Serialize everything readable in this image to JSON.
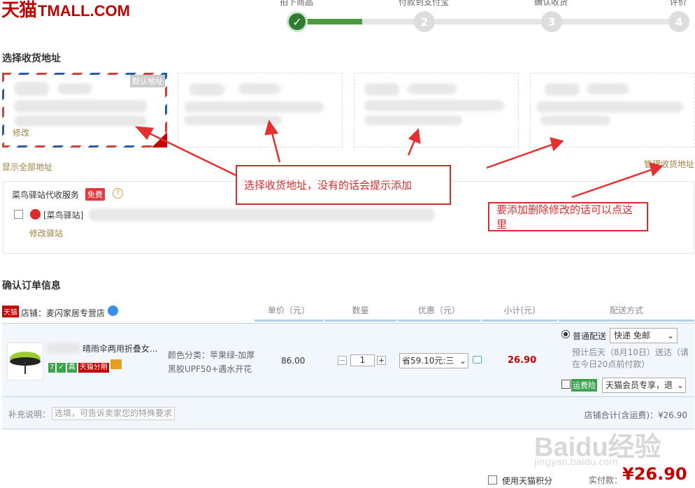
{
  "header": {
    "logo_cn": "天猫",
    "logo_en": "TMALL.COM",
    "steps": [
      {
        "num": "✓",
        "label": "拍下商品"
      },
      {
        "num": "2",
        "label": "付款到支付宝"
      },
      {
        "num": "3",
        "label": "确认收货"
      },
      {
        "num": "4",
        "label": "评价"
      }
    ]
  },
  "address_section": {
    "title": "选择收货地址",
    "default_badge": "默认地址",
    "edit_label": "修改",
    "show_all": "显示全部地址",
    "manage": "管理收货地址"
  },
  "cainiao": {
    "title": "菜鸟驿站代收服务",
    "badge": "免费",
    "help": "?",
    "station_label": "[菜鸟驿站]",
    "edit_station": "修改驿站"
  },
  "annotations": {
    "select_hint": "选择收货地址，没有的话会提示添加",
    "manage_hint": "要添加删除修改的话可以点这里"
  },
  "order": {
    "title": "确认订单信息",
    "shop_badge": "天猫",
    "shop_label": "店铺：麦闪家居专营店",
    "columns": [
      "单价（元）",
      "数量",
      "优惠（元）",
      "小计(元)",
      "配送方式"
    ],
    "item": {
      "name": "晴雨伞两用折叠女...",
      "tags": [
        "7",
        "✓",
        "真",
        "天猫分期"
      ],
      "spec_line1": "颜色分类：苹果绿-加厚",
      "spec_line2": "黑胶UPF50+遇水开花",
      "price": "86.00",
      "qty": "1",
      "minus": "−",
      "plus": "+",
      "discount": "省59.10元:三",
      "subtotal": "26.90"
    },
    "shipping": {
      "option": "普通配送",
      "method": "快递 免邮",
      "estimate": "预计后天（8月10日）送达（请在今日20点前付款）",
      "insurance_badge": "运费险",
      "insurance_select": "天猫会员专享，退"
    },
    "note_label": "补充说明：",
    "note_placeholder": "选填，可告诉卖家您的特殊要求",
    "shop_total": "店铺合计(含运费)：¥26.90"
  },
  "footer": {
    "points_label": "使用天猫积分",
    "pay_label": "实付款：",
    "pay_amount": "¥26.90"
  },
  "watermark": {
    "brand": "Baidu经验",
    "url": "jingyan.baidu.com"
  },
  "colors": {
    "tmall_red": "#c40000",
    "accent_red": "#d92b2b",
    "progress_green": "#4a9a3c",
    "link_brown": "#a08040"
  }
}
